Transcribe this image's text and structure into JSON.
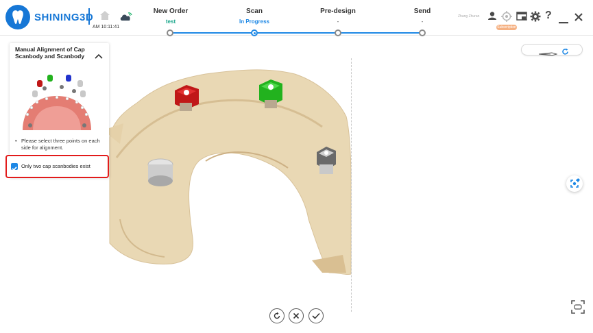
{
  "app": {
    "brand": "SHINING3D",
    "time": "AM 10:11:41",
    "user": "Zhang Zhuran",
    "subscription": "Subscription"
  },
  "colors": {
    "accent": "#1e88e5",
    "brand": "#1677d6",
    "highlight": "#e21b1b",
    "scan_body": "#e9d8b4"
  },
  "steps": [
    {
      "title": "New Order",
      "sub": "test",
      "state": "done"
    },
    {
      "title": "Scan",
      "sub": "In Progress",
      "state": "active"
    },
    {
      "title": "Pre-design",
      "sub": "-",
      "state": "pending"
    },
    {
      "title": "Send",
      "sub": "-",
      "state": "pending"
    }
  ],
  "header_icons": [
    "home-icon",
    "cloud-sync-icon",
    "user-icon",
    "settings-target-icon",
    "window-icon",
    "gear-icon",
    "help-icon",
    "minimize-icon",
    "close-icon"
  ],
  "panel": {
    "title": "Manual Alignment of Cap Scanbody and Scanbody",
    "instruction": "Please select three points on each side for alignment.",
    "checkbox_label": "Only two cap scanbodies exist",
    "checkbox_checked": true
  },
  "bottom_actions": [
    "undo-icon",
    "cancel-icon",
    "confirm-icon"
  ]
}
